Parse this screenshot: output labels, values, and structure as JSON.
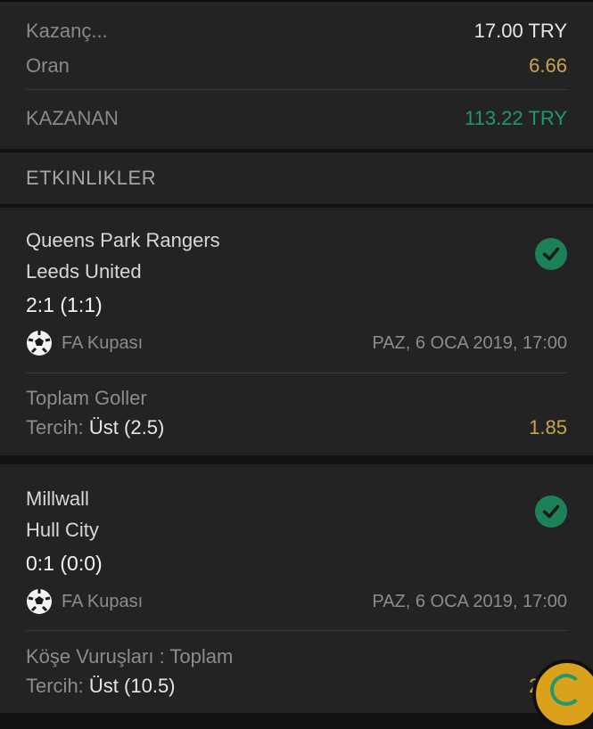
{
  "summary": {
    "stake_label": "Kazanç...",
    "stake_value": "17.00 TRY",
    "odds_label": "Oran",
    "odds_value": "6.66",
    "winnings_label": "KAZANAN",
    "winnings_value": "113.22 TRY"
  },
  "events_section": {
    "title": "ETKINLIKLER"
  },
  "events": [
    {
      "home": "Queens Park Rangers",
      "away": "Leeds United",
      "score": "2:1 (1:1)",
      "league": "FA Kupası",
      "datetime": "PAZ, 6 OCA 2019, 17:00",
      "market": "Toplam Goller",
      "choice_label": "Tercih:",
      "choice_value": "Üst (2.5)",
      "odds": "1.85",
      "status_icon": "check-circle-icon"
    },
    {
      "home": "Millwall",
      "away": "Hull City",
      "score": "0:1 (0:0)",
      "league": "FA Kupası",
      "datetime": "PAZ, 6 OCA 2019, 17:00",
      "market": "Köşe Vuruşları : Toplam",
      "choice_label": "Tercih:",
      "choice_value": "Üst (10.5)",
      "odds": "2.00",
      "status_icon": "check-circle-icon"
    }
  ],
  "colors": {
    "background": "#121212",
    "card": "#232323",
    "gold": "#c7a64a",
    "green": "#1f9a6f",
    "check": "#1d8158"
  }
}
